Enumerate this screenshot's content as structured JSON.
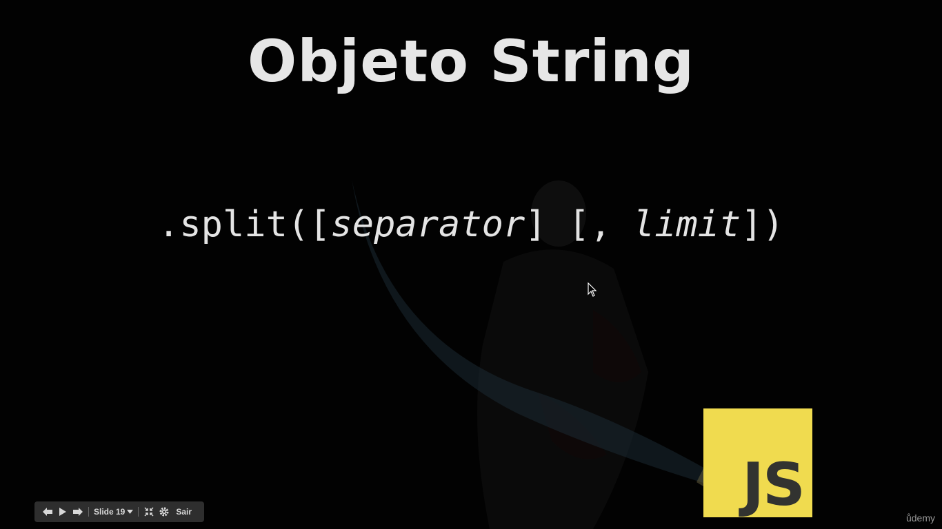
{
  "slide": {
    "title": "Objeto String",
    "code_method": ".split([",
    "code_param1": "separator",
    "code_mid": "] [, ",
    "code_param2": "limit",
    "code_end": "])",
    "logo_text": "JS",
    "logo_color": "#f0db4f"
  },
  "controls": {
    "prev_icon": "arrow-left-icon",
    "play_icon": "play-icon",
    "next_icon": "arrow-right-icon",
    "slide_label": "Slide 19",
    "fullscreen_icon": "exit-fullscreen-icon",
    "settings_icon": "gear-icon",
    "exit_label": "Sair"
  },
  "watermark": "ůdemy"
}
